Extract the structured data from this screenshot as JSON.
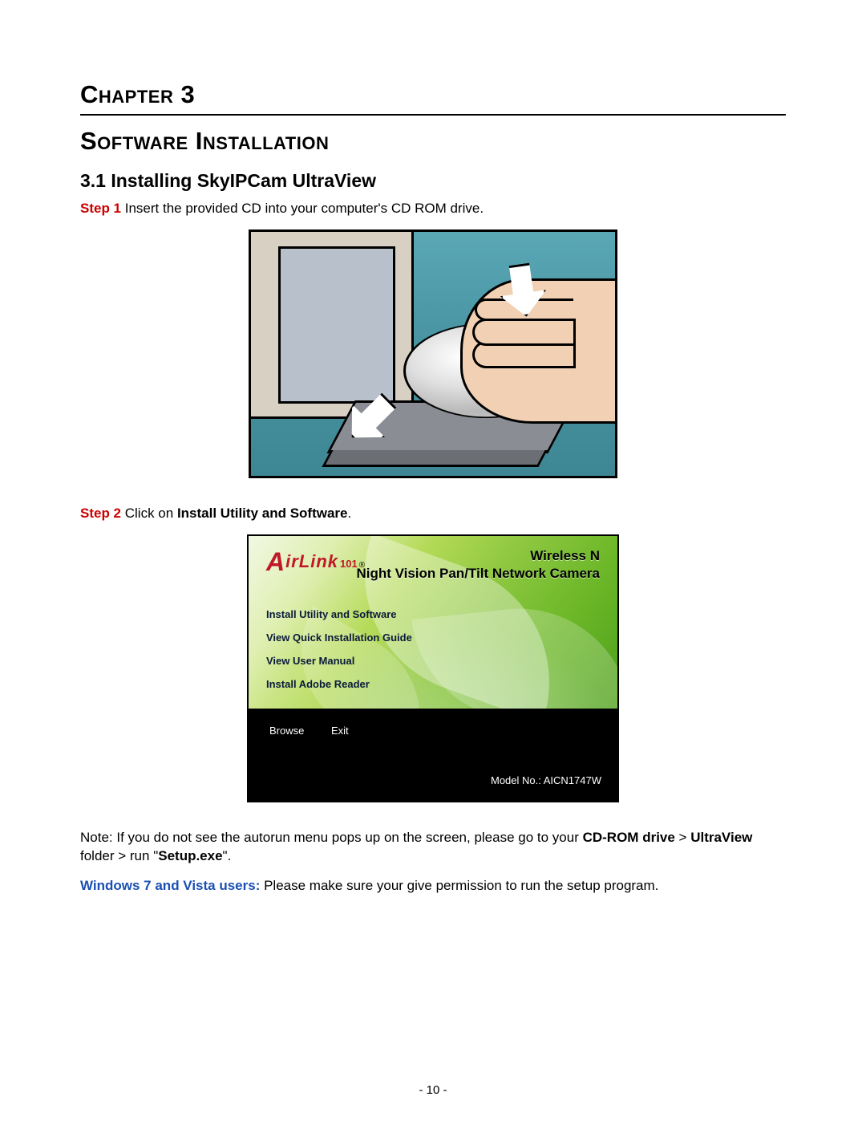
{
  "chapter_label": "Chapter 3",
  "chapter_title": "Software Installation",
  "section_heading": "3.1  Installing SkyIPCam UltraView",
  "step1": {
    "label": "Step 1",
    "text": " Insert the provided CD into your computer's CD ROM drive."
  },
  "step2": {
    "label": "Step 2",
    "text_before": " Click on ",
    "bold": "Install Utility and Software",
    "text_after": "."
  },
  "installer": {
    "brand_part1": "A",
    "brand_part2": "irLink",
    "brand_sub": "101",
    "brand_reg": "®",
    "title_line1": "Wireless N",
    "title_line2": "Night Vision Pan/Tilt Network Camera",
    "menu": [
      "Install Utility and Software",
      "View Quick Installation Guide",
      "View User Manual",
      "Install Adobe Reader"
    ],
    "btn_browse": "Browse",
    "btn_exit": "Exit",
    "model": "Model No.: AICN1747W"
  },
  "note": {
    "prefix": "Note: If you do not see the autorun menu pops up on the screen, please go to your ",
    "bold1": "CD-ROM drive",
    "mid1": " > ",
    "bold2": "UltraView",
    "mid2": " folder > run \"",
    "bold3": "Setup.exe",
    "suffix": "\"."
  },
  "win_note": {
    "bold": "Windows 7 and Vista users:",
    "text": " Please make sure your give permission to run the setup program."
  },
  "page_number": "- 10 -"
}
